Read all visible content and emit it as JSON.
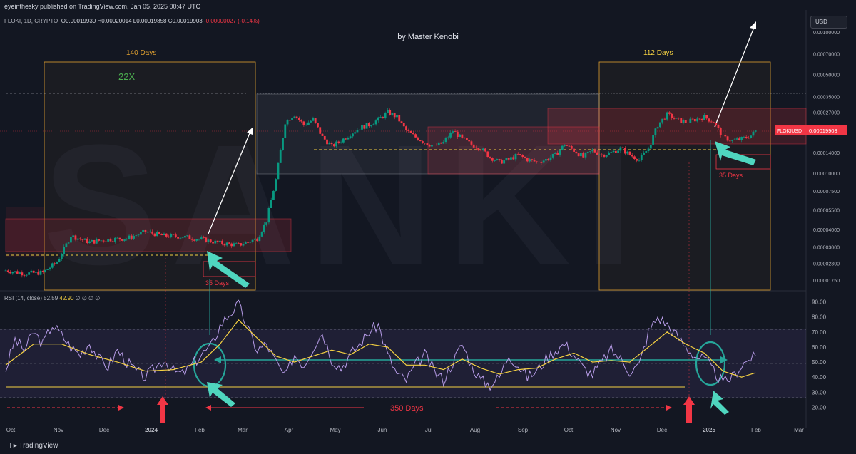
{
  "header": {
    "published": "eyeinthesky published on TradingView.com, Jan 05, 2025 00:47 UTC",
    "symbol_line": "FLOKI, 1D, CRYPTO",
    "ohlc": {
      "o": "O0.00019930",
      "h": "H0.00020014",
      "l": "L0.00019858",
      "c": "C0.00019903",
      "chg": "-0.00000027 (-0.14%)"
    },
    "author": "by Master Kenobi",
    "rsi_label": "RSI (14, close)",
    "rsi_value": "52.59",
    "rsi_ma_value": "42.90",
    "rsi_extra": "∅ ∅ ∅ ∅",
    "footer_brand": "TradingView",
    "currency": "USD",
    "watermark": "SANKI"
  },
  "colors": {
    "background": "#131722",
    "candle_up": "#089981",
    "candle_down": "#f23645",
    "rsi_line": "#b79ce8",
    "rsi_ma": "#f5d142",
    "annotation_teal": "#26a69a",
    "annotation_red": "#f23645",
    "box_orange": "#e0a030"
  },
  "chart_data": {
    "type": "candlestick-with-rsi",
    "x_ticks": [
      "Oct",
      "Nov",
      "Dec",
      "2024",
      "Feb",
      "Mar",
      "Apr",
      "May",
      "Jun",
      "Jul",
      "Aug",
      "Sep",
      "Oct",
      "Nov",
      "Dec",
      "2025",
      "Feb",
      "Mar"
    ],
    "price_axis": {
      "scale": "log",
      "ticks": [
        "0.00100000",
        "0.00070000",
        "0.00050000",
        "0.00035000",
        "0.00027000",
        "0.00014000",
        "0.00010000",
        "0.00007500",
        "0.00005500",
        "0.00004000",
        "0.00003000",
        "0.00002300",
        "0.00001750"
      ],
      "current_symbol": "FLOKIUSD",
      "current_value": "0.00019903"
    },
    "rsi_axis": {
      "ticks": [
        "90.00",
        "80.00",
        "70.00",
        "60.00",
        "50.00",
        "40.00",
        "30.00",
        "20.00"
      ],
      "range": [
        15,
        95
      ]
    },
    "price_path": [
      [
        0,
        2.05e-05
      ],
      [
        4,
        1.95e-05
      ],
      [
        8,
        1.98e-05
      ],
      [
        11,
        2.35e-05
      ],
      [
        14,
        3.6e-05
      ],
      [
        18,
        3.25e-05
      ],
      [
        22,
        3.4e-05
      ],
      [
        26,
        3.45e-05
      ],
      [
        30,
        3.85e-05
      ],
      [
        34,
        3.6e-05
      ],
      [
        38,
        3.55e-05
      ],
      [
        42,
        3.4e-05
      ],
      [
        46,
        3.2e-05
      ],
      [
        50,
        3.1e-05
      ],
      [
        52,
        3.25e-05
      ],
      [
        54,
        3.45e-05
      ],
      [
        56,
        4.6e-05
      ],
      [
        58,
        9e-05
      ],
      [
        60,
        0.00023
      ],
      [
        62,
        0.00026
      ],
      [
        64,
        0.00022
      ],
      [
        66,
        0.00024
      ],
      [
        68,
        0.00018
      ],
      [
        70,
        0.000155
      ],
      [
        72,
        0.00017
      ],
      [
        74,
        0.00019
      ],
      [
        76,
        0.00021
      ],
      [
        78,
        0.00022
      ],
      [
        80,
        0.00024
      ],
      [
        82,
        0.00027
      ],
      [
        84,
        0.00025
      ],
      [
        86,
        0.0002
      ],
      [
        88,
        0.00018
      ],
      [
        90,
        0.000165
      ],
      [
        92,
        0.000155
      ],
      [
        94,
        0.000165
      ],
      [
        96,
        0.0002
      ],
      [
        98,
        0.000175
      ],
      [
        100,
        0.00016
      ],
      [
        102,
        0.00015
      ],
      [
        104,
        0.00013
      ],
      [
        106,
        0.00012
      ],
      [
        108,
        0.000125
      ],
      [
        110,
        0.000135
      ],
      [
        112,
        0.000125
      ],
      [
        114,
        0.00012
      ],
      [
        116,
        0.000125
      ],
      [
        118,
        0.000135
      ],
      [
        120,
        0.00016
      ],
      [
        122,
        0.000145
      ],
      [
        124,
        0.00013
      ],
      [
        126,
        0.000145
      ],
      [
        128,
        0.000135
      ],
      [
        130,
        0.00014
      ],
      [
        132,
        0.00015
      ],
      [
        134,
        0.000135
      ],
      [
        136,
        0.000125
      ],
      [
        138,
        0.00015
      ],
      [
        140,
        0.00022
      ],
      [
        142,
        0.00026
      ],
      [
        144,
        0.00024
      ],
      [
        146,
        0.00023
      ],
      [
        148,
        0.00024
      ],
      [
        150,
        0.00025
      ],
      [
        152,
        0.00023
      ],
      [
        154,
        0.00018
      ],
      [
        156,
        0.00017
      ],
      [
        158,
        0.000175
      ],
      [
        160,
        0.000185
      ],
      [
        161,
        0.000199
      ]
    ],
    "rsi_path": [
      [
        0,
        45
      ],
      [
        2,
        65
      ],
      [
        4,
        58
      ],
      [
        6,
        70
      ],
      [
        8,
        62
      ],
      [
        10,
        75
      ],
      [
        12,
        68
      ],
      [
        14,
        60
      ],
      [
        16,
        55
      ],
      [
        18,
        63
      ],
      [
        20,
        52
      ],
      [
        22,
        47
      ],
      [
        24,
        58
      ],
      [
        26,
        50
      ],
      [
        28,
        44
      ],
      [
        30,
        40
      ],
      [
        32,
        46
      ],
      [
        34,
        52
      ],
      [
        36,
        44
      ],
      [
        38,
        42
      ],
      [
        40,
        48
      ],
      [
        42,
        55
      ],
      [
        44,
        60
      ],
      [
        46,
        74
      ],
      [
        48,
        82
      ],
      [
        50,
        88
      ],
      [
        52,
        72
      ],
      [
        54,
        58
      ],
      [
        56,
        62
      ],
      [
        58,
        50
      ],
      [
        60,
        40
      ],
      [
        62,
        55
      ],
      [
        64,
        48
      ],
      [
        66,
        60
      ],
      [
        68,
        70
      ],
      [
        70,
        52
      ],
      [
        72,
        46
      ],
      [
        74,
        55
      ],
      [
        76,
        62
      ],
      [
        78,
        70
      ],
      [
        80,
        75
      ],
      [
        82,
        55
      ],
      [
        84,
        42
      ],
      [
        86,
        38
      ],
      [
        88,
        48
      ],
      [
        90,
        55
      ],
      [
        92,
        44
      ],
      [
        94,
        38
      ],
      [
        96,
        50
      ],
      [
        98,
        62
      ],
      [
        100,
        48
      ],
      [
        102,
        38
      ],
      [
        104,
        35
      ],
      [
        106,
        40
      ],
      [
        108,
        55
      ],
      [
        110,
        48
      ],
      [
        112,
        40
      ],
      [
        114,
        44
      ],
      [
        116,
        52
      ],
      [
        118,
        58
      ],
      [
        120,
        62
      ],
      [
        122,
        55
      ],
      [
        124,
        46
      ],
      [
        126,
        42
      ],
      [
        128,
        50
      ],
      [
        130,
        58
      ],
      [
        132,
        52
      ],
      [
        134,
        44
      ],
      [
        136,
        48
      ],
      [
        138,
        70
      ],
      [
        140,
        80
      ],
      [
        142,
        75
      ],
      [
        144,
        68
      ],
      [
        146,
        60
      ],
      [
        148,
        54
      ],
      [
        150,
        52
      ],
      [
        152,
        44
      ],
      [
        154,
        36
      ],
      [
        156,
        40
      ],
      [
        158,
        48
      ],
      [
        160,
        53
      ],
      [
        161,
        52.59
      ]
    ],
    "rsi_ma_path": [
      [
        0,
        48
      ],
      [
        6,
        62
      ],
      [
        12,
        62
      ],
      [
        18,
        55
      ],
      [
        24,
        50
      ],
      [
        30,
        44
      ],
      [
        36,
        45
      ],
      [
        42,
        50
      ],
      [
        46,
        62
      ],
      [
        50,
        78
      ],
      [
        54,
        66
      ],
      [
        58,
        54
      ],
      [
        62,
        50
      ],
      [
        66,
        54
      ],
      [
        70,
        58
      ],
      [
        74,
        55
      ],
      [
        78,
        62
      ],
      [
        82,
        60
      ],
      [
        86,
        48
      ],
      [
        90,
        48
      ],
      [
        94,
        45
      ],
      [
        98,
        52
      ],
      [
        102,
        46
      ],
      [
        106,
        42
      ],
      [
        110,
        45
      ],
      [
        114,
        46
      ],
      [
        118,
        52
      ],
      [
        122,
        56
      ],
      [
        126,
        50
      ],
      [
        130,
        51
      ],
      [
        134,
        50
      ],
      [
        138,
        60
      ],
      [
        142,
        70
      ],
      [
        146,
        62
      ],
      [
        150,
        56
      ],
      [
        154,
        44
      ],
      [
        158,
        40
      ],
      [
        161,
        42.9
      ]
    ]
  },
  "annotations": {
    "box1_label": "140 Days",
    "box2_label": "112 Days",
    "gain_label": "22X",
    "days35_left": "35 Days",
    "days35_right": "35 Days",
    "days350": "350 Days"
  }
}
